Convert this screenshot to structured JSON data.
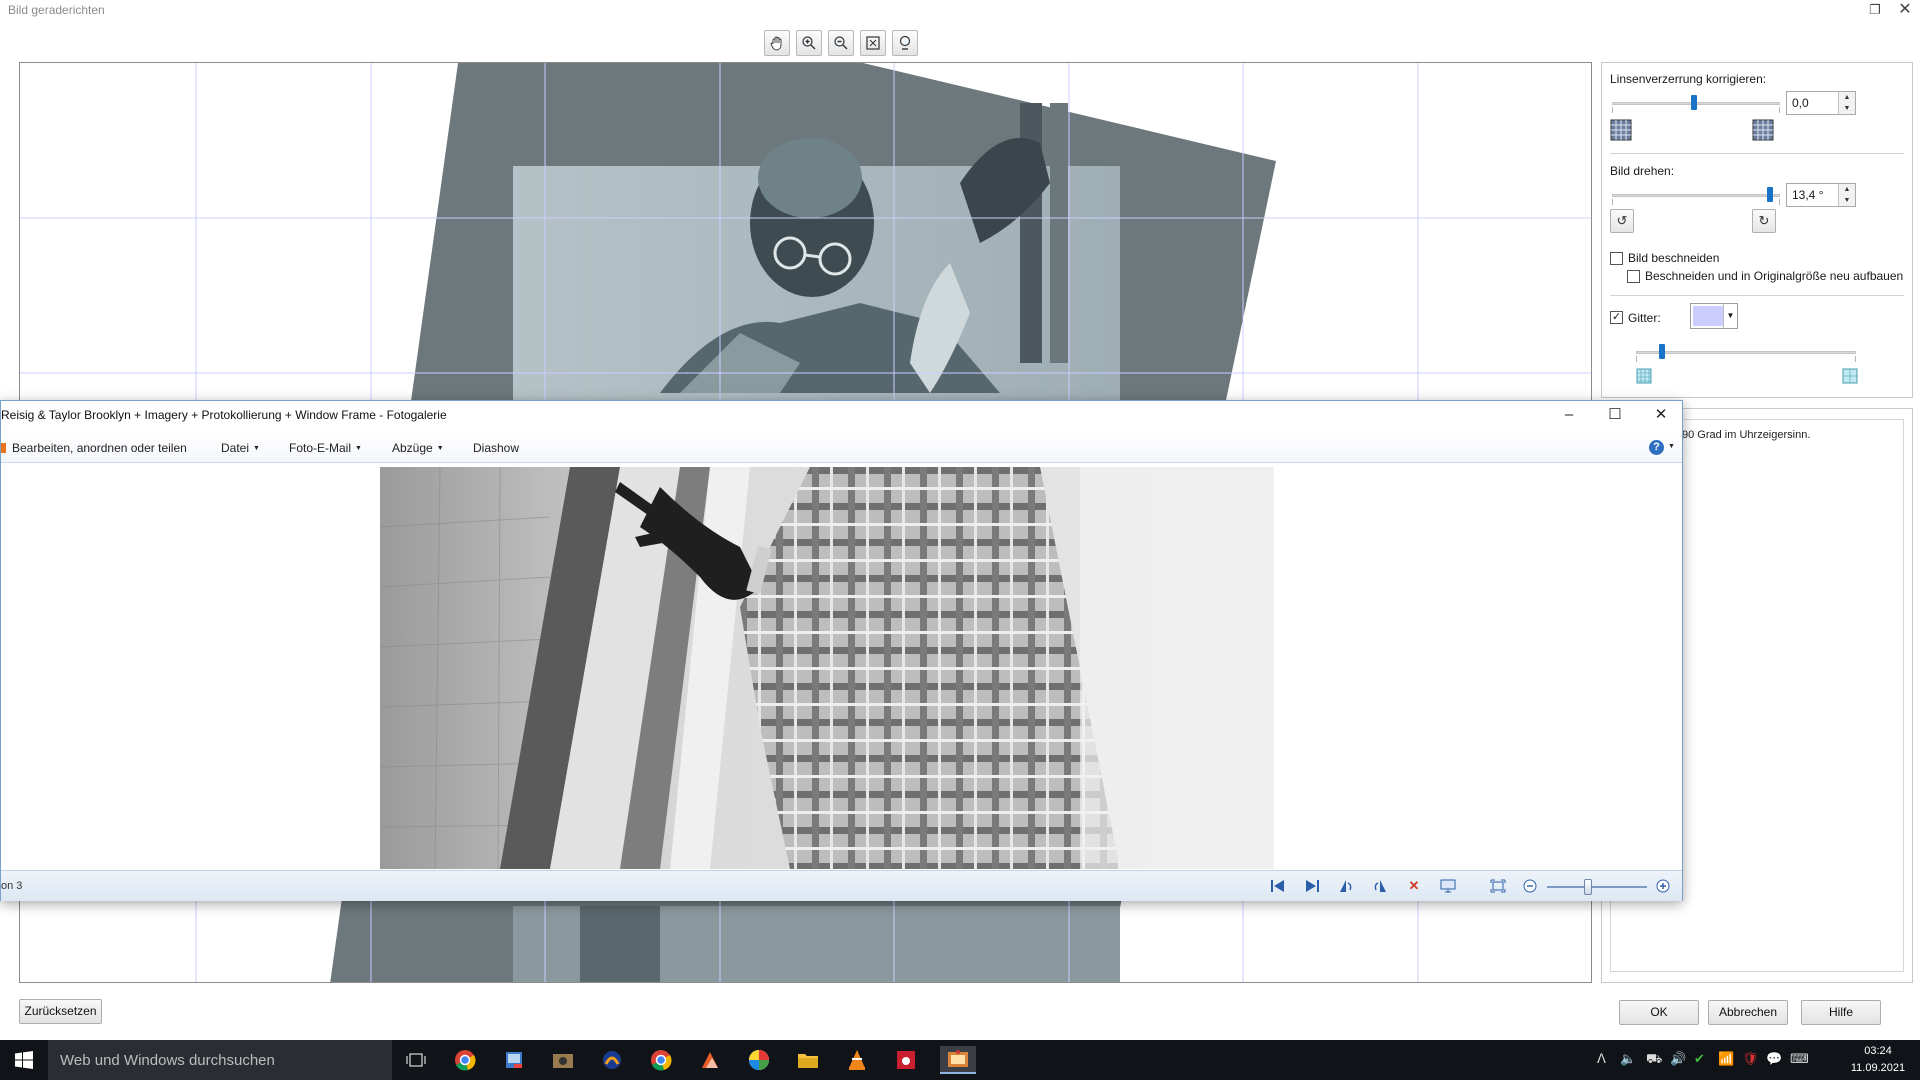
{
  "straighten_dialog": {
    "title": "Bild geraderichten",
    "toolbar_icons": [
      "hand-icon",
      "zoom-in-icon",
      "zoom-out-icon",
      "fit-to-window-icon",
      "actual-size-icon"
    ],
    "lens": {
      "label": "Linsenverzerrung korrigieren:",
      "value": "0,0",
      "slider_fraction": 0.5
    },
    "rotate": {
      "label": "Bild drehen:",
      "value": "13,4 °",
      "slider_fraction": 0.95
    },
    "crop": {
      "label": "Bild beschneiden",
      "checked": false,
      "sub_label": "Beschneiden und in Originalgröße neu aufbauen",
      "sub_checked": false
    },
    "grid": {
      "label": "Gitter:",
      "checked": true,
      "color": "#ccccff",
      "slider_fraction": 0.12
    },
    "help_text": "90 Grad im Uhrzeigersinn.",
    "buttons": {
      "reset": "Zurücksetzen",
      "ok": "OK",
      "cancel": "Abbrechen",
      "help": "Hilfe"
    }
  },
  "photo_gallery": {
    "title": "Reisig & Taylor Brooklyn + Imagery +  Protokollierung + Window Frame - Fotogalerie",
    "menu": {
      "edit": "Bearbeiten, anordnen oder teilen",
      "file": "Datei",
      "email": "Foto-E-Mail",
      "prints": "Abzüge",
      "slideshow": "Diashow"
    },
    "status_text": "on 3",
    "zoom_fraction": 0.45
  },
  "taskbar": {
    "search_placeholder": "Web und Windows durchsuchen",
    "time": "03:24",
    "date": "11.09.2021"
  }
}
